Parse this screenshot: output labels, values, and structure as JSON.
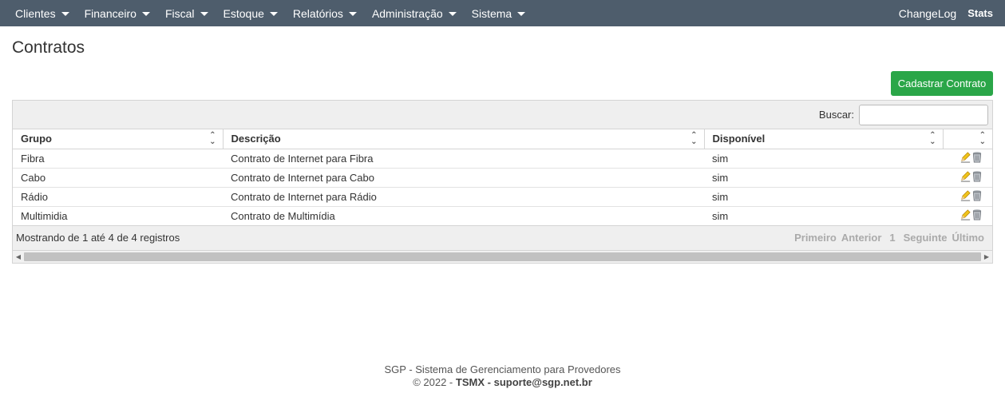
{
  "nav": {
    "menus": [
      "Clientes",
      "Financeiro",
      "Fiscal",
      "Estoque",
      "Relatórios",
      "Administração",
      "Sistema"
    ],
    "changelog": "ChangeLog",
    "stats": "Stats"
  },
  "page": {
    "title": "Contratos",
    "add_button": "Cadastrar Contrato"
  },
  "table": {
    "search_label": "Buscar:",
    "search_value": "",
    "columns": [
      "Grupo",
      "Descrição",
      "Disponível",
      ""
    ],
    "rows": [
      {
        "grupo": "Fibra",
        "descricao": "Contrato de Internet para Fibra",
        "disponivel": "sim"
      },
      {
        "grupo": "Cabo",
        "descricao": "Contrato de Internet para Cabo",
        "disponivel": "sim"
      },
      {
        "grupo": "Rádio",
        "descricao": "Contrato de Internet para Rádio",
        "disponivel": "sim"
      },
      {
        "grupo": "Multimidia",
        "descricao": "Contrato de Multimídia",
        "disponivel": "sim"
      }
    ],
    "info": "Mostrando de 1 até 4 de 4 registros",
    "pager": {
      "first": "Primeiro",
      "prev": "Anterior",
      "page": "1",
      "next": "Seguinte",
      "last": "Último"
    }
  },
  "footer": {
    "line1": "SGP - Sistema de Gerenciamento para Provedores",
    "copyright": "© 2022 -",
    "company": "TSMX",
    "separator": "-",
    "email": "suporte@sgp.net.br"
  },
  "colors": {
    "navbar": "#4e5d6c",
    "primary_button": "#2aa648",
    "toolbar_bg": "#efefef"
  },
  "icons": {
    "edit": "pencil-icon",
    "delete": "trash-icon",
    "sort": "sort-icon",
    "dropdown": "caret-down-icon"
  }
}
